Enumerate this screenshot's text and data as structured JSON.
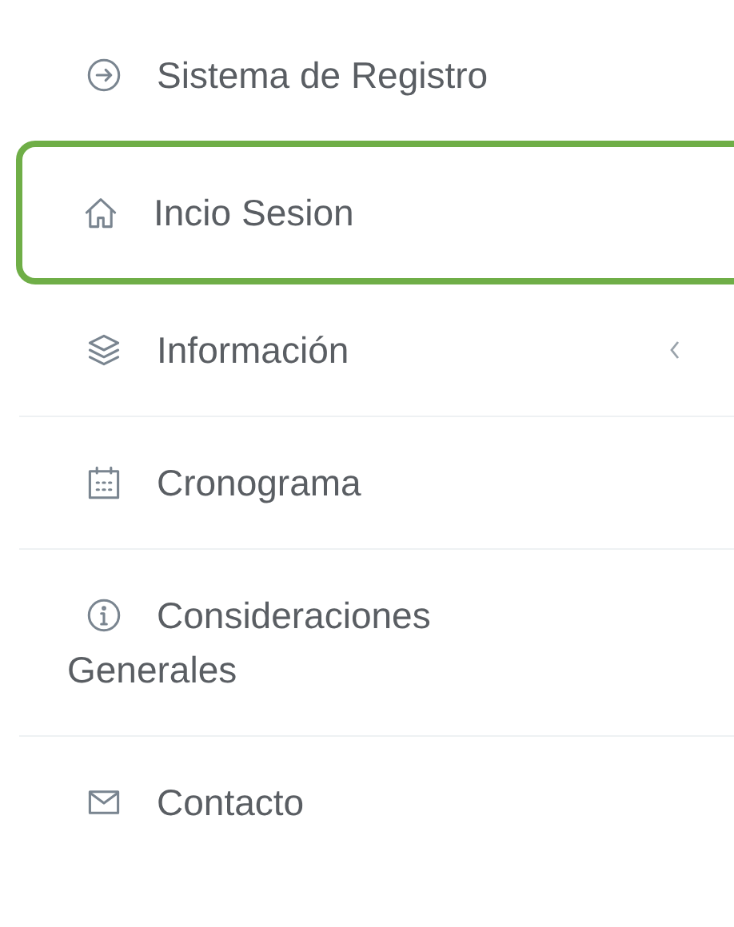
{
  "menu": {
    "items": [
      {
        "kind": "arrow-circle",
        "label": "Sistema de Registro",
        "selected": false,
        "has_submenu": false
      },
      {
        "kind": "home",
        "label": "Incio Sesion",
        "selected": true,
        "has_submenu": false
      },
      {
        "kind": "layers",
        "label": "Información",
        "selected": false,
        "has_submenu": true
      },
      {
        "kind": "calendar",
        "label": "Cronograma",
        "selected": false,
        "has_submenu": false
      },
      {
        "kind": "info",
        "label": "Consideraciones Generales",
        "selected": false,
        "has_submenu": false
      },
      {
        "kind": "mail",
        "label": "Contacto",
        "selected": false,
        "has_submenu": false
      }
    ]
  }
}
